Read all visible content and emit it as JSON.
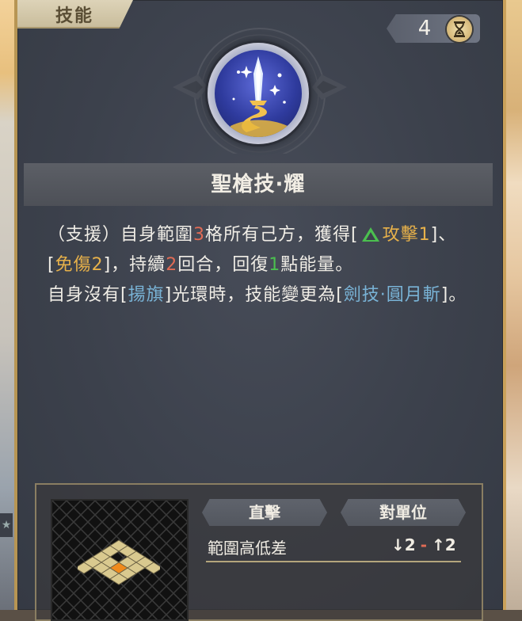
{
  "tab_label": "技能",
  "counter": {
    "value": "4",
    "icon": "hourglass-icon"
  },
  "skill_icon": "holy-spear-icon",
  "skill_title": "聖槍技·耀",
  "description": {
    "p1": "（支援）自身範圍",
    "range": "3",
    "p2": "格所有己方，獲得[",
    "buff1": "攻擊1",
    "p3": "]、[",
    "buff2": "免傷2",
    "p4": "]，持續",
    "duration": "2",
    "p5": "回合，回復",
    "energy": "1",
    "p6": "點能量。",
    "p7": "自身沒有[",
    "aura": "揚旗",
    "p8": "]光環時，技能變更為[",
    "alt_skill": "劍技·圓月斬",
    "p9": "]。"
  },
  "info": {
    "attack_type": "直擊",
    "target_type": "對單位",
    "height_label": "範圍高低差",
    "height_down": "↓2",
    "height_sep": "-",
    "height_up": "↑2"
  },
  "colors": {
    "number": "#e06b55",
    "buff": "#e7b14a",
    "energy": "#4bc04f",
    "skill_link": "#79b3d6"
  }
}
